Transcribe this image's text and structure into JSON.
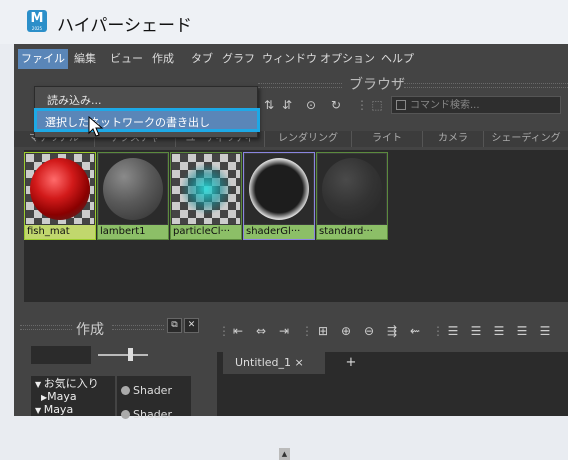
{
  "window": {
    "title": "ハイパーシェード",
    "icon_letter": "M",
    "icon_sub": "2025"
  },
  "menubar": {
    "items": [
      "ファイル",
      "編集",
      "ビュー",
      "作成",
      "タブ",
      "グラフ",
      "ウィンドウ",
      "オプション",
      "ヘルプ"
    ]
  },
  "file_menu": {
    "items": [
      "読み込み...",
      "選択したネットワークの書き出し"
    ]
  },
  "browser": {
    "title": "ブラウザ",
    "search_placeholder": "コマンド検索..."
  },
  "tabs": [
    "マテリアル",
    "テクスチャ",
    "ユーティリティ",
    "レンダリング",
    "ライト",
    "カメラ",
    "シェーディング"
  ],
  "swatches": [
    {
      "label": "fish_mat",
      "state": "selected"
    },
    {
      "label": "lambert1",
      "state": "normal"
    },
    {
      "label": "particleCl···",
      "state": "normal"
    },
    {
      "label": "shaderGl···",
      "state": "highlighted"
    },
    {
      "label": "standard···",
      "state": "normal"
    }
  ],
  "create_panel": {
    "title": "作成",
    "tree": [
      {
        "label": "お気に入り"
      },
      {
        "label": "Maya"
      },
      {
        "label": "Maya"
      }
    ],
    "shaders": [
      "Shader",
      "Shader"
    ]
  },
  "graph": {
    "tab_label": "Untitled_1",
    "tab_close": "×",
    "add_tab": "+"
  },
  "colors": {
    "accent": "#1da9e6",
    "menu_active": "#5a86b8",
    "swatch_border": "#9ccd2e"
  }
}
